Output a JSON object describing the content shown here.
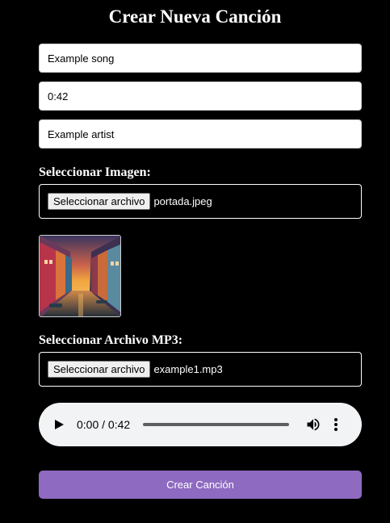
{
  "form": {
    "title": "Crear Nueva Canción",
    "song_name": "Example song",
    "duration": "0:42",
    "artist": "Example artist",
    "image_label": "Seleccionar Imagen:",
    "image_button": "Seleccionar archivo",
    "image_filename": "portada.jpeg",
    "mp3_label": "Seleccionar Archivo MP3:",
    "mp3_button": "Seleccionar archivo",
    "mp3_filename": "example1.mp3",
    "audio_time": "0:00 / 0:42",
    "submit_label": "Crear Canción"
  },
  "icons": {
    "preview": "canal-street-sunset-image",
    "play": "play-icon",
    "volume": "volume-icon",
    "more": "more-vertical-icon"
  },
  "colors": {
    "background": "#000000",
    "accent": "#8e6ac1",
    "player_bg": "#f1f3f4"
  }
}
